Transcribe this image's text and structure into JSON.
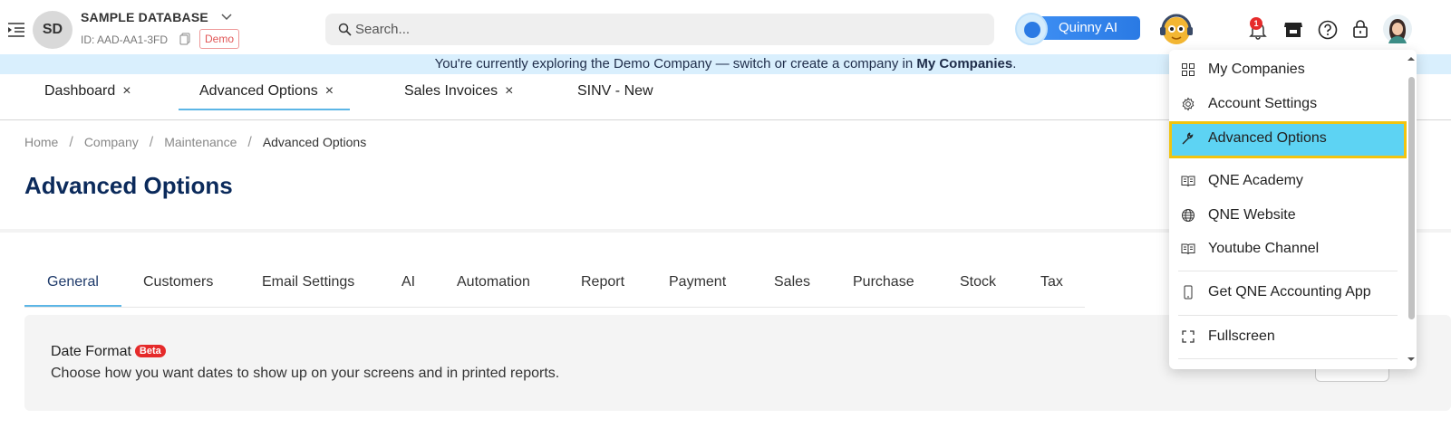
{
  "header": {
    "avatar_initials": "SD",
    "db_name": "SAMPLE DATABASE",
    "db_id": "ID: AAD-AA1-3FD",
    "demo_label": "Demo",
    "search_placeholder": "Search...",
    "ai_label": "Quinny AI",
    "notification_count": "1"
  },
  "banner": {
    "text": "You're currently exploring the Demo Company — switch or create a company in ",
    "link": "My Companies",
    "suffix": "."
  },
  "open_tabs": [
    {
      "label": "Dashboard",
      "closable": true
    },
    {
      "label": "Advanced Options",
      "closable": true,
      "active": true
    },
    {
      "label": "Sales Invoices",
      "closable": true
    },
    {
      "label": "SINV - New",
      "closable": false
    }
  ],
  "close_glyph": "×",
  "breadcrumb": {
    "items": [
      "Home",
      "Company",
      "Maintenance"
    ],
    "current": "Advanced Options",
    "separator": "/"
  },
  "page": {
    "title": "Advanced Options"
  },
  "option_tabs": [
    "General",
    "Customers",
    "Email Settings",
    "AI",
    "Automation",
    "Report",
    "Payment",
    "Sales",
    "Purchase",
    "Stock",
    "Tax"
  ],
  "active_option_tab": "General",
  "date_format_panel": {
    "title": "Date Format",
    "badge": "Beta",
    "description": "Choose how you want dates to show up on your screens and in printed reports."
  },
  "user_menu": {
    "items": [
      {
        "label": "My Companies",
        "icon": "grid-icon"
      },
      {
        "label": "Account Settings",
        "icon": "gear-icon"
      },
      {
        "label": "Advanced Options",
        "icon": "wrench-icon",
        "selected": true
      },
      {
        "label": "QNE Academy",
        "icon": "book-icon"
      },
      {
        "label": "QNE Website",
        "icon": "globe-icon"
      },
      {
        "label": "Youtube Channel",
        "icon": "book-icon"
      },
      {
        "label": "Get QNE Accounting App",
        "icon": "phone-icon"
      },
      {
        "label": "Fullscreen",
        "icon": "fullscreen-icon"
      }
    ]
  },
  "colors": {
    "accent": "#5cb6e6",
    "banner_bg": "#d9effd",
    "title": "#0b2a5b",
    "selected_item_bg": "#5dd3f3",
    "selected_item_border": "#f1c40f",
    "badge_red": "#e52a2a"
  }
}
